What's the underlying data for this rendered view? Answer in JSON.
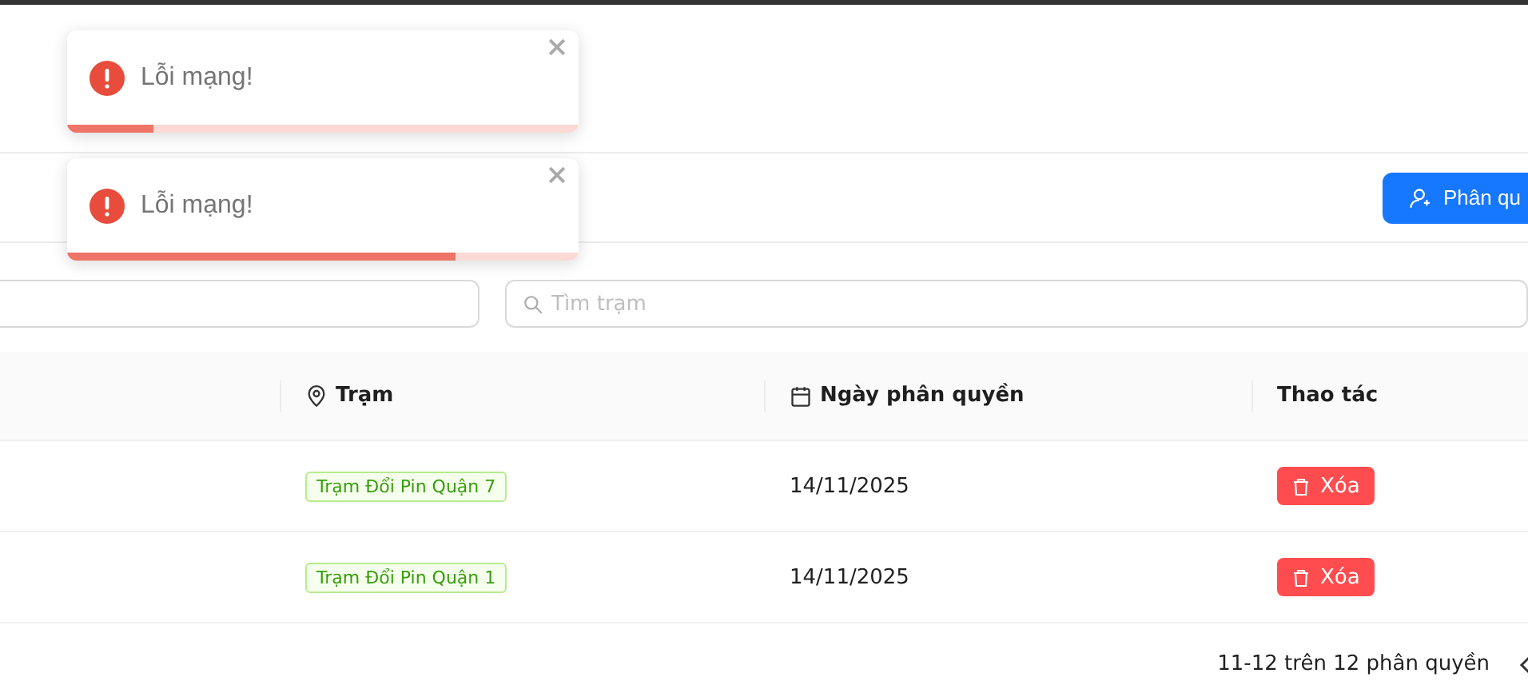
{
  "toasts": [
    {
      "message": "Lỗi mạng!",
      "level": 0.17
    },
    {
      "message": "Lỗi mạng!",
      "level": 0.76
    }
  ],
  "toolbar": {
    "button": "Phân qu"
  },
  "filters": {
    "search": {
      "placeholder": "Tìm trạm"
    }
  },
  "table": {
    "columns": [
      {
        "label": "Trạm"
      },
      {
        "label": "Ngày phân quyền"
      },
      {
        "label": "Thao tác"
      }
    ],
    "rows": [
      {
        "station": "Trạm Đổi Pin Quận 7",
        "date": "14/11/2025",
        "action": "Xóa"
      },
      {
        "station": "Trạm Đổi Pin Quận 1",
        "date": "14/11/2025",
        "action": "Xóa"
      }
    ]
  },
  "pagination": {
    "summary": "11-12 trên 12 phân quyền"
  }
}
